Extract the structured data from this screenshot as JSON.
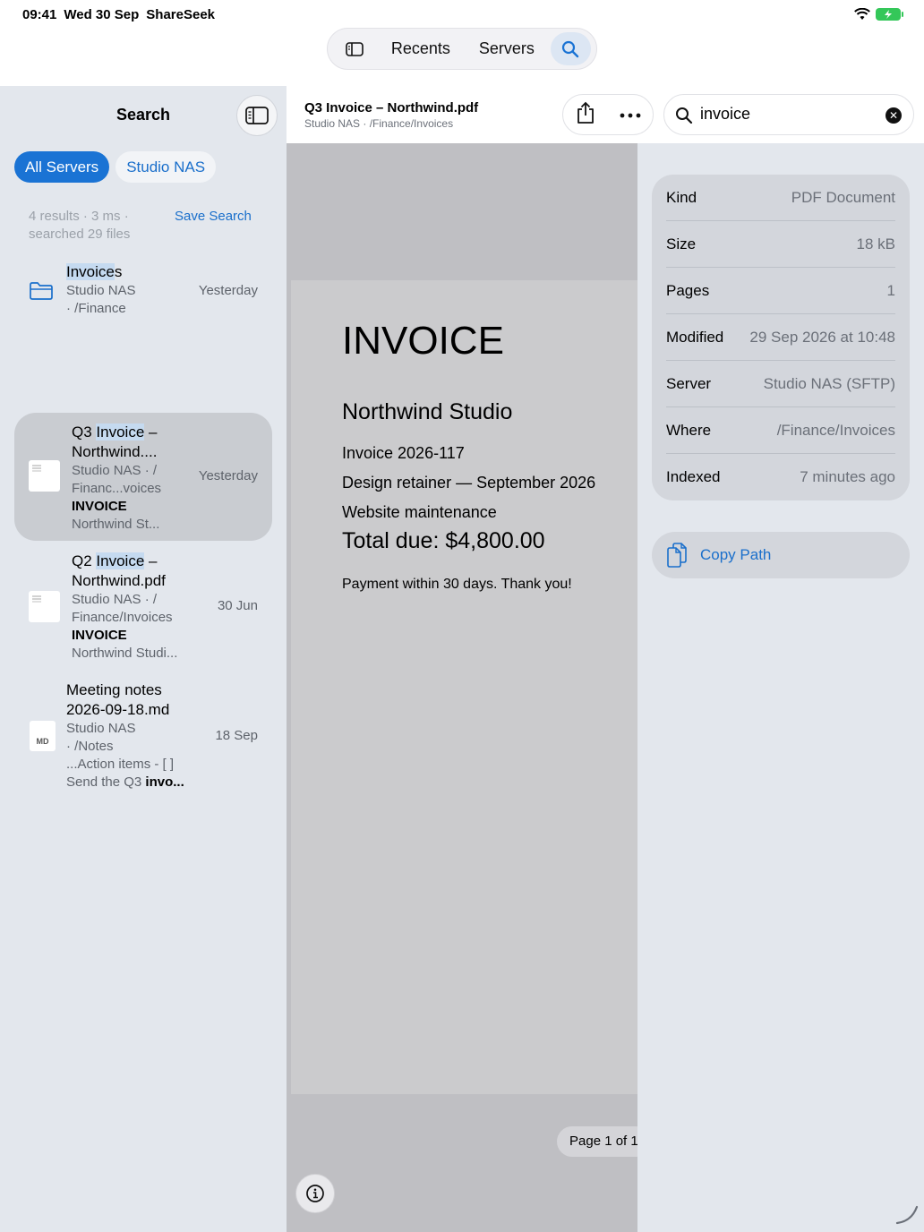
{
  "status": {
    "time": "09:41",
    "date": "Wed 30 Sep",
    "app": "ShareSeek"
  },
  "nav": {
    "recents": "Recents",
    "servers": "Servers"
  },
  "sidebar": {
    "title": "Search",
    "chips": [
      "All Servers",
      "Studio NAS"
    ],
    "meta_line1": "4 results · 3 ms ·",
    "meta_line2": "searched 29 files",
    "save_search": "Save Search",
    "results": [
      {
        "name_hl": "Invoice",
        "name_rest": "s",
        "path1": "Studio NAS",
        "path2": "· /Finance",
        "date": "Yesterday"
      },
      {
        "name_pre": "Q3 ",
        "name_hl": "Invoice",
        "name_rest": " –",
        "name_line2": "Northwind....",
        "path1": "Studio NAS · /",
        "path2": "Financ...voices",
        "snip_bold": "INVOICE",
        "snip": "Northwind St...",
        "date": "Yesterday"
      },
      {
        "name_pre": "Q2 ",
        "name_hl": "Invoice",
        "name_rest": " –",
        "name_line2": "Northwind.pdf",
        "path1": "Studio NAS · /",
        "path2": "Finance/Invoices",
        "snip_bold": "INVOICE",
        "snip": "Northwind Studi...",
        "date": "30 Jun"
      },
      {
        "name_line1": "Meeting notes",
        "name_line2": "2026-09-18.md",
        "path1": "Studio NAS",
        "path2": "· /Notes",
        "snip1": "...Action items - [ ]",
        "snip2_pre": "Send the Q3 ",
        "snip2_bold": "invo...",
        "date": "18 Sep",
        "thumb_label": "MD"
      }
    ]
  },
  "document": {
    "title": "Q3 Invoice – Northwind.pdf",
    "subtitle": "Studio NAS · /Finance/Invoices",
    "heading": "INVOICE",
    "company": "Northwind Studio",
    "lines": [
      "Invoice 2026-117",
      "Design retainer — September 2026",
      "Website maintenance"
    ],
    "total": "Total due: $4,800.00",
    "payment": "Payment within 30 days. Thank you!",
    "page_indicator": "Page 1 of 1"
  },
  "search": {
    "value": "invoice"
  },
  "inspector": {
    "rows": [
      {
        "key": "Kind",
        "value": "PDF Document"
      },
      {
        "key": "Size",
        "value": "18 kB"
      },
      {
        "key": "Pages",
        "value": "1"
      },
      {
        "key": "Modified",
        "value": "29 Sep 2026 at 10:48"
      },
      {
        "key": "Server",
        "value": "Studio NAS (SFTP)"
      },
      {
        "key": "Where",
        "value": "/Finance/Invoices"
      },
      {
        "key": "Indexed",
        "value": "7 minutes ago"
      }
    ],
    "copy_path": "Copy Path"
  },
  "colors": {
    "accent": "#1a73d4",
    "sidebar_bg": "#e3e7ed",
    "selected_row": "#c9ccd1",
    "highlight": "#c5daf0"
  },
  "icons": [
    "wifi-icon",
    "battery-icon",
    "sidebar-icon",
    "search-icon",
    "folder-icon",
    "share-icon",
    "more-icon",
    "clear-icon",
    "info-icon",
    "copy-icon"
  ]
}
